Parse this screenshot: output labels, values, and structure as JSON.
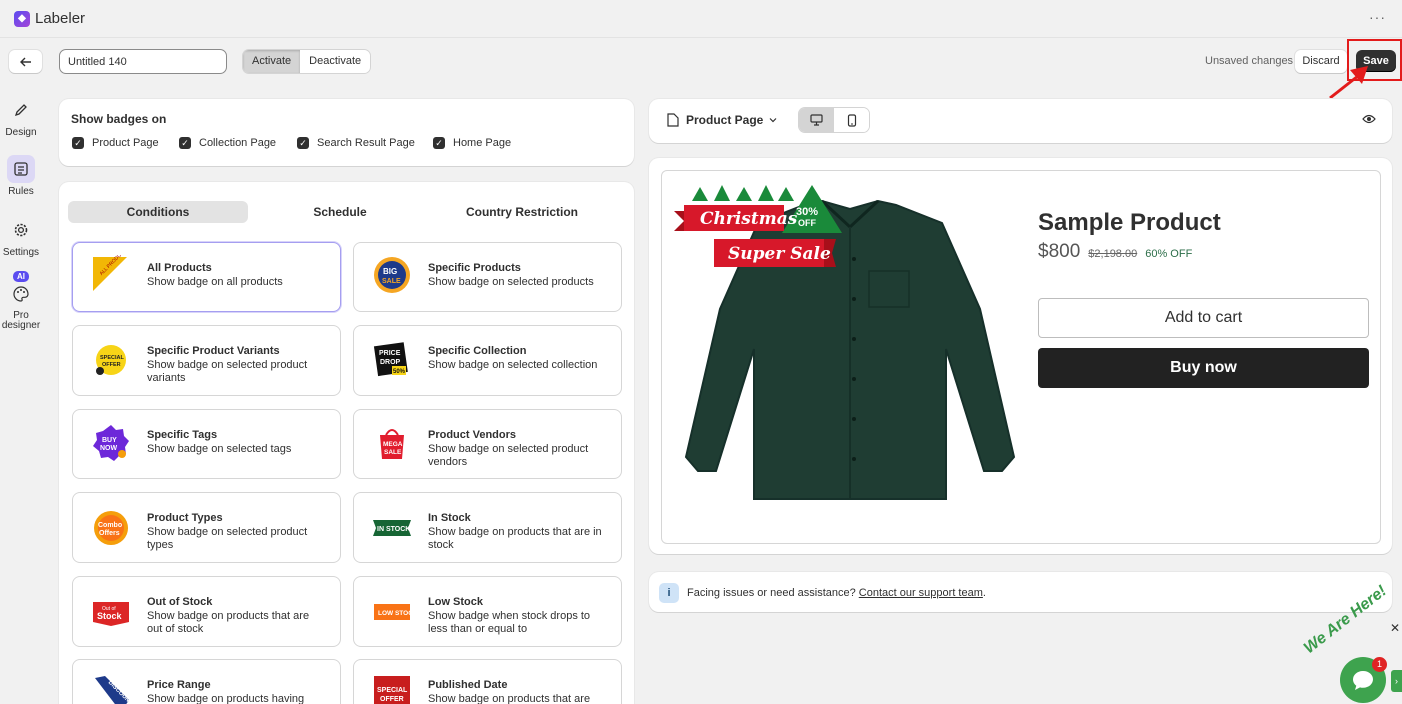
{
  "app": {
    "title": "Labeler",
    "more_label": "···"
  },
  "toolbar": {
    "badge_name": "Untitled 140",
    "activate_label": "Activate",
    "deactivate_label": "Deactivate",
    "unsaved_label": "Unsaved changes",
    "discard_label": "Discard",
    "save_label": "Save"
  },
  "nav": [
    {
      "label": "Design",
      "icon": "pencil-icon"
    },
    {
      "label": "Rules",
      "icon": "rules-icon",
      "active": true
    },
    {
      "label": "Settings",
      "icon": "gear-icon"
    },
    {
      "label": "Pro designer",
      "icon": "palette-icon",
      "badge": "AI"
    }
  ],
  "show_badges": {
    "title": "Show badges on",
    "options": [
      {
        "label": "Product Page",
        "checked": true
      },
      {
        "label": "Collection Page",
        "checked": true
      },
      {
        "label": "Search Result Page",
        "checked": true
      },
      {
        "label": "Home Page",
        "checked": true
      }
    ]
  },
  "tabs": [
    "Conditions",
    "Schedule",
    "Country Restriction"
  ],
  "conditions": [
    {
      "title": "All Products",
      "desc": "Show badge on all products",
      "icon": "all-products-badge-icon",
      "badge_text": "ALL PRODUCTS",
      "selected": true
    },
    {
      "title": "Specific Products",
      "desc": "Show badge on selected products",
      "icon": "big-sale-badge-icon",
      "badge_text": "BIG SALE"
    },
    {
      "title": "Specific Product Variants",
      "desc": "Show badge on selected product variants",
      "icon": "special-offer-badge-icon",
      "badge_text": "SPECIAL OFFER"
    },
    {
      "title": "Specific Collection",
      "desc": "Show badge on selected collection",
      "icon": "price-drop-badge-icon",
      "badge_text": "PRICE DROP 50%"
    },
    {
      "title": "Specific Tags",
      "desc": "Show badge on selected tags",
      "icon": "buy-now-badge-icon",
      "badge_text": "BUY NOW"
    },
    {
      "title": "Product Vendors",
      "desc": "Show badge on selected product vendors",
      "icon": "mega-sale-badge-icon",
      "badge_text": "MEGA SALE"
    },
    {
      "title": "Product Types",
      "desc": "Show badge on selected product types",
      "icon": "combo-offers-badge-icon",
      "badge_text": "Combo Offers"
    },
    {
      "title": "In Stock",
      "desc": "Show badge on products that are in stock",
      "icon": "in-stock-badge-icon",
      "badge_text": "IN STOCK"
    },
    {
      "title": "Out of Stock",
      "desc": "Show badge on products that are out of stock",
      "icon": "out-of-stock-badge-icon",
      "badge_text": "Out of Stock"
    },
    {
      "title": "Low Stock",
      "desc": "Show badge when stock drops to less than or equal to",
      "icon": "low-stock-badge-icon",
      "badge_text": "LOW STOCK"
    },
    {
      "title": "Price Range",
      "desc": "Show badge on products having price",
      "icon": "discount-badge-icon",
      "badge_text": "DISCOUNT"
    },
    {
      "title": "Published Date",
      "desc": "Show badge on products that are",
      "icon": "special-offer-tag-icon",
      "badge_text": "SPECIAL OFFER"
    }
  ],
  "preview": {
    "page_select": "Product Page",
    "product_title": "Sample Product",
    "price": "$800",
    "compare_price": "$2,198.00",
    "discount": "60% OFF",
    "add_to_cart": "Add to cart",
    "buy_now": "Buy now",
    "badge": {
      "line1": "Christmas",
      "line2": "Super Sale",
      "percent": "30%",
      "off": "OFF"
    },
    "shirt_color": "#1f3d33"
  },
  "help": {
    "text": "Facing issues or need assistance?",
    "link": "Contact our support team",
    "suffix": "."
  },
  "chat": {
    "text": "We Are Here!",
    "count": "1",
    "close": "✕",
    "tab": "›"
  },
  "colors": {
    "accent": "#303030",
    "highlight": "#e31b1b",
    "brand": "#5b4cf0",
    "chat": "#3ea34e"
  }
}
